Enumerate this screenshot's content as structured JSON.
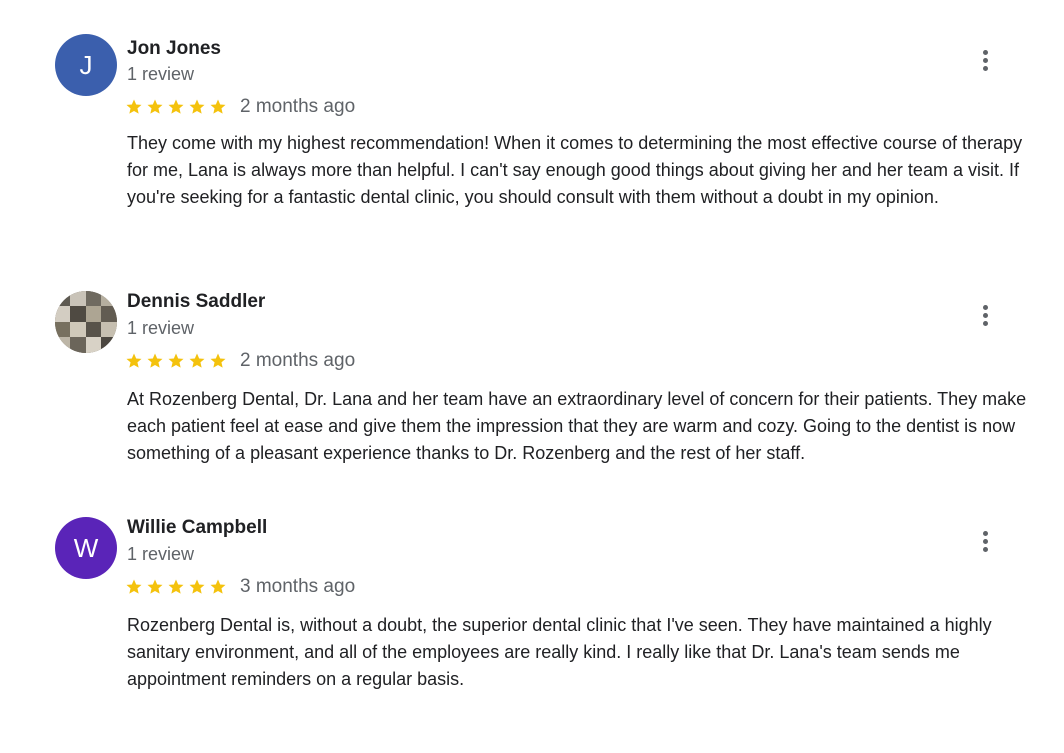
{
  "colors": {
    "star": "#f4c20d",
    "avatar_j": "#3b5fad",
    "avatar_w": "#5a24b8"
  },
  "reviews": [
    {
      "avatar_letter": "J",
      "author": "Jon Jones",
      "review_count": "1 review",
      "rating": 5,
      "time": "2 months ago",
      "text": "They come with my highest recommendation! When it comes to determining the most effective course of therapy for me, Lana is always more than helpful. I can't say enough good things about giving her and her team a visit. If you're seeking for a fantastic dental clinic, you should consult with them without a doubt in my opinion."
    },
    {
      "avatar_letter": "",
      "author": "Dennis Saddler",
      "review_count": "1 review",
      "rating": 5,
      "time": "2 months ago",
      "text": "At Rozenberg Dental, Dr. Lana and her team have an extraordinary level of concern for their patients. They make each patient feel at ease and give them the impression that they are warm and cozy. Going to the dentist is now something of a pleasant experience thanks to Dr. Rozenberg and the rest of her staff."
    },
    {
      "avatar_letter": "W",
      "author": "Willie Campbell",
      "review_count": "1 review",
      "rating": 5,
      "time": "3 months ago",
      "text": "Rozenberg Dental is, without a doubt, the superior dental clinic that I've seen. They have maintained a highly sanitary environment, and all of the employees are really kind. I really like that Dr. Lana's team sends me appointment reminders on a regular basis."
    }
  ]
}
